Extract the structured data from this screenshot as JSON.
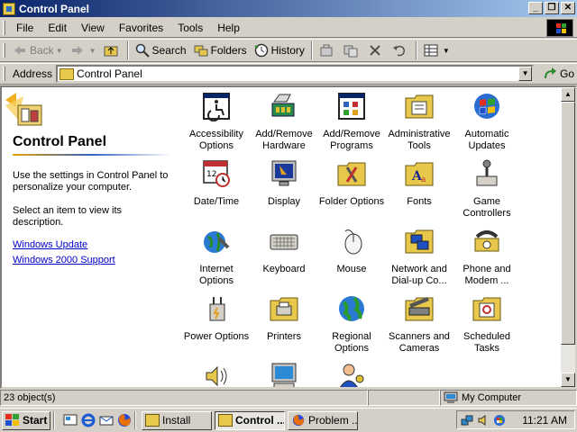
{
  "window": {
    "title": "Control Panel",
    "buttons": [
      "minimize",
      "restore",
      "close"
    ]
  },
  "menu": [
    "File",
    "Edit",
    "View",
    "Favorites",
    "Tools",
    "Help"
  ],
  "toolbar": {
    "back": "Back",
    "search": "Search",
    "folders": "Folders",
    "history": "History"
  },
  "address": {
    "label": "Address",
    "value": "Control Panel",
    "go": "Go"
  },
  "left_panel": {
    "title": "Control Panel",
    "desc1": "Use the settings in Control Panel to personalize your computer.",
    "desc2": "Select an item to view its description.",
    "links": [
      "Windows Update",
      "Windows 2000 Support"
    ]
  },
  "items": [
    {
      "label": "Accessibility Options",
      "icon": "accessibility-icon"
    },
    {
      "label": "Add/Remove Hardware",
      "icon": "hardware-icon"
    },
    {
      "label": "Add/Remove Programs",
      "icon": "programs-icon"
    },
    {
      "label": "Administrative Tools",
      "icon": "admin-tools-icon"
    },
    {
      "label": "Automatic Updates",
      "icon": "windows-update-icon"
    },
    {
      "label": "Date/Time",
      "icon": "calendar-clock-icon"
    },
    {
      "label": "Display",
      "icon": "display-icon"
    },
    {
      "label": "Folder Options",
      "icon": "folder-options-icon"
    },
    {
      "label": "Fonts",
      "icon": "fonts-icon"
    },
    {
      "label": "Game Controllers",
      "icon": "joystick-icon"
    },
    {
      "label": "Internet Options",
      "icon": "internet-icon"
    },
    {
      "label": "Keyboard",
      "icon": "keyboard-icon"
    },
    {
      "label": "Mouse",
      "icon": "mouse-icon"
    },
    {
      "label": "Network and Dial-up Co...",
      "icon": "network-icon"
    },
    {
      "label": "Phone and Modem ...",
      "icon": "phone-icon"
    },
    {
      "label": "Power Options",
      "icon": "power-icon"
    },
    {
      "label": "Printers",
      "icon": "printers-icon"
    },
    {
      "label": "Regional Options",
      "icon": "globe-icon"
    },
    {
      "label": "Scanners and Cameras",
      "icon": "scanner-icon"
    },
    {
      "label": "Scheduled Tasks",
      "icon": "scheduled-tasks-icon"
    },
    {
      "label": "",
      "icon": "sounds-icon"
    },
    {
      "label": "",
      "icon": "system-icon"
    },
    {
      "label": "",
      "icon": "users-icon"
    }
  ],
  "status": {
    "count": "23 object(s)",
    "zone": "My Computer"
  },
  "taskbar": {
    "start": "Start",
    "tasks": [
      "Install",
      "Control ...",
      "Problem ..."
    ],
    "clock": "11:21 AM"
  },
  "colors": {
    "titlebar_start": "#0a246a",
    "titlebar_end": "#a6caf0",
    "face": "#d4d0c8",
    "link": "#0000cc"
  }
}
